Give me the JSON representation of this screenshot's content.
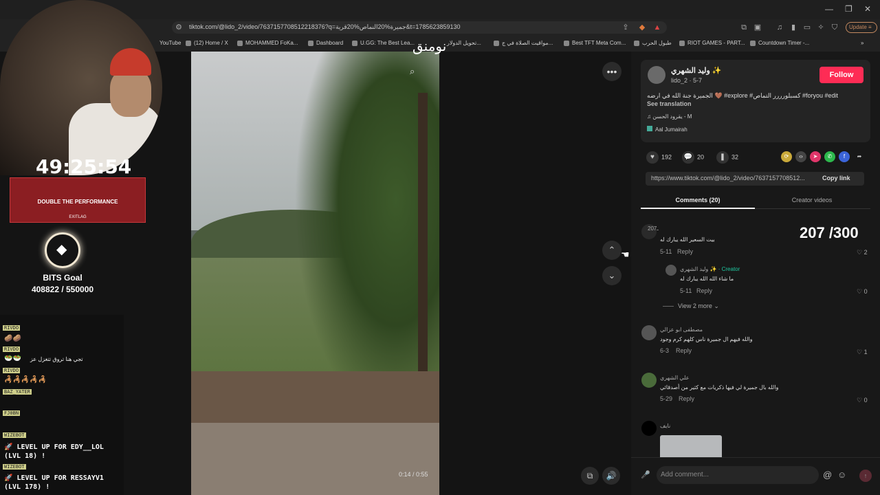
{
  "browser": {
    "url": "tiktok.com/@lido_2/video/7637157708512218376?q=جميرة%20النماص%20قرية&t=1785623859130",
    "update_label": "Update",
    "bookmarks": [
      "YouTube",
      "(12) Home / X",
      "MOHAMMED FoKa...",
      "Dashboard",
      "U.GG: The Best Lea...",
      "تحويل الدولار...",
      "مواقيت الصلاة في ج...",
      "Best TFT Meta Com...",
      "طبول الحرب",
      "RIOT GAMES - PART...",
      "Countdown Timer -..."
    ]
  },
  "video": {
    "overlay_label": "نومنق",
    "time_text": "0:14 / 0:55"
  },
  "post": {
    "author_name": "وليد الشهري ✨",
    "author_handle": "lido_2 · 5-7",
    "follow_label": "Follow",
    "caption": "الجميرة جنة الله في ارضه 🤎 #explore #كسبلورررر التماص #foryou #edit",
    "see_translation": "See translation",
    "music": "♫ يقرود الحسن - M",
    "location": "Aal Jumairah",
    "likes": "192",
    "comments_count": "20",
    "saves": "32",
    "link": "https://www.tiktok.com/@lido_2/video/7637157708512...",
    "copy_link_label": "Copy link"
  },
  "tabs": {
    "comments": "Comments (20)",
    "creator": "Creator videos"
  },
  "comments": [
    {
      "name": "ـ207",
      "text": "بيت السعير الله يبارك له",
      "date": "5-11",
      "reply": "Reply",
      "likes": "2"
    },
    {
      "name": "وليد الشهري ✨",
      "tag": "· Creator",
      "text": "ما شاء الله الله يبارك له",
      "date": "5-11",
      "reply": "Reply",
      "likes": "0"
    },
    {
      "name": "مصطفى ابو عزالي",
      "text": "والله فيهم ال جميرة ناس كلهم كرم وجود",
      "date": "6-3",
      "reply": "Reply",
      "likes": "1"
    },
    {
      "name": "علي الشهري",
      "text": "والله بال جميرة لي فيها ذكريات مع كثير من أصدقائي",
      "date": "5-29",
      "reply": "Reply",
      "likes": "0"
    },
    {
      "name": "نايف"
    }
  ],
  "view_more": "View 2 more ⌄",
  "comment_placeholder": "Add comment...",
  "stream": {
    "timer": "49:25:54",
    "promo_text": "DOUBLE THE PERFORMANCE",
    "promo_brand": "EXITLAG",
    "bits_label": "BITS Goal",
    "bits_value": "408822 / 550000",
    "countdown": "207 /300",
    "chat": [
      {
        "name": "RIVDO",
        "msg": ""
      },
      {
        "name": "RIVDO",
        "msg": ""
      },
      {
        "name": "RIVDO",
        "msg": "تجي هنا تروق تتغزل عز"
      },
      {
        "name": "BAZ_YATER",
        "msg": ""
      },
      {
        "name": "FJ0BN",
        "msg": ""
      },
      {
        "name": "WIZEBOT",
        "msg": ""
      }
    ],
    "level_ups": [
      "🚀 LEVEL UP FOR EDY__LOL (LVL 18) !",
      "🚀 LEVEL UP FOR RESSAYV1 (LVL 178) !"
    ],
    "level_bot": "WIZEBOT"
  }
}
